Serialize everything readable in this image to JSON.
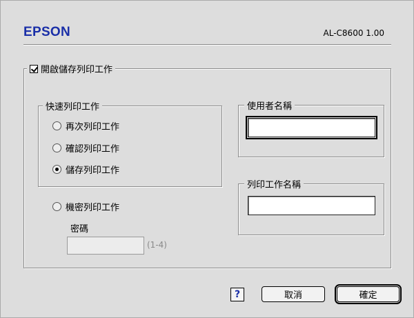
{
  "header": {
    "brand": "EPSON",
    "model": "AL-C8600 1.00"
  },
  "main_group": {
    "enable_label": "開啟儲存列印工作",
    "enabled": true
  },
  "quick_print_group": {
    "legend": "快速列印工作",
    "options": [
      {
        "label": "再次列印工作",
        "selected": false
      },
      {
        "label": "確認列印工作",
        "selected": false
      },
      {
        "label": "儲存列印工作",
        "selected": true
      }
    ]
  },
  "confidential": {
    "label": "機密列印工作",
    "selected": false,
    "password_label": "密碼",
    "password_value": "",
    "password_hint": "(1-4)"
  },
  "user_group": {
    "legend": "使用者名稱",
    "value": ""
  },
  "job_group": {
    "legend": "列印工作名稱",
    "value": ""
  },
  "buttons": {
    "help": "?",
    "cancel": "取消",
    "ok": "確定"
  },
  "colors": {
    "brand": "#1a2fa8",
    "dialog_bg": "#dddddd"
  }
}
